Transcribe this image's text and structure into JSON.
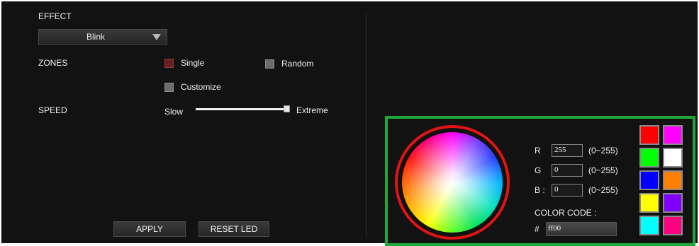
{
  "effect": {
    "label": "EFFECT",
    "selected": "Blink"
  },
  "zones": {
    "label": "ZONES",
    "options": [
      {
        "label": "Single",
        "checked": true
      },
      {
        "label": "Random",
        "checked": false
      },
      {
        "label": "Customize",
        "checked": false
      }
    ]
  },
  "speed": {
    "label": "SPEED",
    "min_label": "Slow",
    "max_label": "Extreme",
    "value_fraction": 1.0
  },
  "buttons": {
    "apply": "APPLY",
    "reset": "RESET LED"
  },
  "color": {
    "r_label": "R",
    "g_label": "G",
    "b_label": "B :",
    "r": "255",
    "g": "0",
    "b": "0",
    "range": "(0~255)",
    "code_label": "COLOR CODE :",
    "hash": "#",
    "code": "ff00"
  },
  "swatches": [
    "#ff0000",
    "#ff00ff",
    "#00ff00",
    "#ffffff",
    "#0000ff",
    "#ff7f00",
    "#ffff00",
    "#7f00ff",
    "#00ffff",
    "#ff0080"
  ],
  "accent": {
    "frame": "#1fa83a",
    "ring": "#e01414"
  }
}
